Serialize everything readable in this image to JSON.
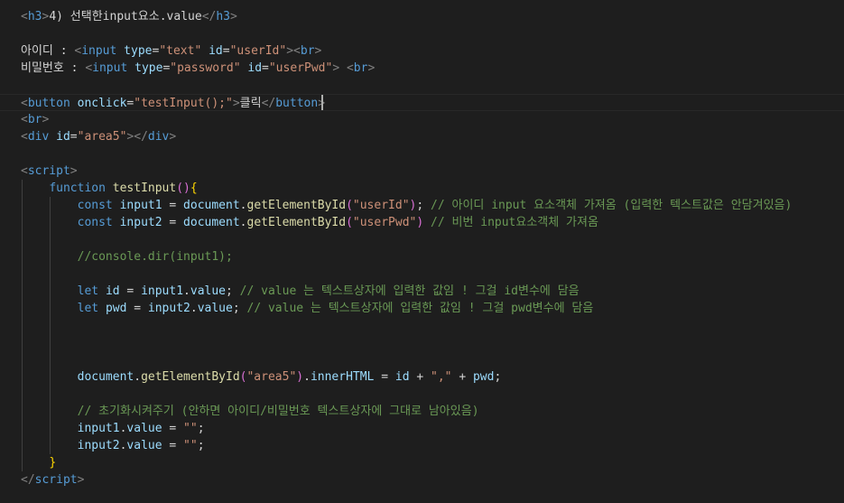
{
  "colors": {
    "tag": "#569cd6",
    "bracket": "#808080",
    "attr": "#9cdcfe",
    "string": "#ce9178",
    "text": "#d4d4d4",
    "keyword": "#569cd6",
    "function": "#dcdcaa",
    "comment": "#6a9955",
    "brace": "#ffd700",
    "paren": "#da70d6"
  },
  "lines": [
    [
      [
        "<",
        "bracket"
      ],
      [
        "h3",
        "tag"
      ],
      [
        ">",
        "bracket"
      ],
      [
        "4) 선택한input요소.value",
        "text"
      ],
      [
        "</",
        "bracket"
      ],
      [
        "h3",
        "tag"
      ],
      [
        ">",
        "bracket"
      ]
    ],
    [],
    [
      [
        "아이디 : ",
        "text"
      ],
      [
        "<",
        "bracket"
      ],
      [
        "input",
        "tag"
      ],
      [
        " ",
        "text"
      ],
      [
        "type",
        "attr"
      ],
      [
        "=",
        "text"
      ],
      [
        "\"text\"",
        "string"
      ],
      [
        " ",
        "text"
      ],
      [
        "id",
        "attr"
      ],
      [
        "=",
        "text"
      ],
      [
        "\"userId\"",
        "string"
      ],
      [
        ">",
        "bracket"
      ],
      [
        "<",
        "bracket"
      ],
      [
        "br",
        "tag"
      ],
      [
        ">",
        "bracket"
      ]
    ],
    [
      [
        "비밀번호 : ",
        "text"
      ],
      [
        "<",
        "bracket"
      ],
      [
        "input",
        "tag"
      ],
      [
        " ",
        "text"
      ],
      [
        "type",
        "attr"
      ],
      [
        "=",
        "text"
      ],
      [
        "\"password\"",
        "string"
      ],
      [
        " ",
        "text"
      ],
      [
        "id",
        "attr"
      ],
      [
        "=",
        "text"
      ],
      [
        "\"userPwd\"",
        "string"
      ],
      [
        ">",
        "bracket"
      ],
      [
        " ",
        "text"
      ],
      [
        "<",
        "bracket"
      ],
      [
        "br",
        "tag"
      ],
      [
        ">",
        "bracket"
      ]
    ],
    [],
    [
      [
        "<",
        "bracket"
      ],
      [
        "button",
        "tag"
      ],
      [
        " ",
        "text"
      ],
      [
        "onclick",
        "attr"
      ],
      [
        "=",
        "text"
      ],
      [
        "\"testInput();\"",
        "string"
      ],
      [
        ">",
        "bracket"
      ],
      [
        "클릭",
        "text"
      ],
      [
        "</",
        "bracket"
      ],
      [
        "button",
        "tag"
      ],
      [
        ">",
        "bracket"
      ]
    ],
    [
      [
        "<",
        "bracket"
      ],
      [
        "br",
        "tag"
      ],
      [
        ">",
        "bracket"
      ]
    ],
    [
      [
        "<",
        "bracket"
      ],
      [
        "div",
        "tag"
      ],
      [
        " ",
        "text"
      ],
      [
        "id",
        "attr"
      ],
      [
        "=",
        "text"
      ],
      [
        "\"area5\"",
        "string"
      ],
      [
        ">",
        "bracket"
      ],
      [
        "</",
        "bracket"
      ],
      [
        "div",
        "tag"
      ],
      [
        ">",
        "bracket"
      ]
    ],
    [],
    [
      [
        "<",
        "bracket"
      ],
      [
        "script",
        "tag"
      ],
      [
        ">",
        "bracket"
      ]
    ],
    [
      [
        "    ",
        "text"
      ],
      [
        "function",
        "keyword"
      ],
      [
        " ",
        "text"
      ],
      [
        "testInput",
        "function"
      ],
      [
        "()",
        "paren"
      ],
      [
        "{",
        "brace"
      ]
    ],
    [
      [
        "        ",
        "text"
      ],
      [
        "const",
        "keyword"
      ],
      [
        " ",
        "text"
      ],
      [
        "input1",
        "attr"
      ],
      [
        " = ",
        "text"
      ],
      [
        "document",
        "attr"
      ],
      [
        ".",
        "text"
      ],
      [
        "getElementById",
        "function"
      ],
      [
        "(",
        "paren"
      ],
      [
        "\"userId\"",
        "string"
      ],
      [
        ")",
        "paren"
      ],
      [
        "; ",
        "text"
      ],
      [
        "// 아이디 input 요소객체 가져옴 (입력한 텍스트값은 안담겨있음)",
        "comment"
      ]
    ],
    [
      [
        "        ",
        "text"
      ],
      [
        "const",
        "keyword"
      ],
      [
        " ",
        "text"
      ],
      [
        "input2",
        "attr"
      ],
      [
        " = ",
        "text"
      ],
      [
        "document",
        "attr"
      ],
      [
        ".",
        "text"
      ],
      [
        "getElementById",
        "function"
      ],
      [
        "(",
        "paren"
      ],
      [
        "\"userPwd\"",
        "string"
      ],
      [
        ")",
        "paren"
      ],
      [
        " ",
        "text"
      ],
      [
        "// 비번 input요소객체 가져옴",
        "comment"
      ]
    ],
    [],
    [
      [
        "        ",
        "text"
      ],
      [
        "//console.dir(input1);",
        "comment"
      ]
    ],
    [],
    [
      [
        "        ",
        "text"
      ],
      [
        "let",
        "keyword"
      ],
      [
        " ",
        "text"
      ],
      [
        "id",
        "attr"
      ],
      [
        " = ",
        "text"
      ],
      [
        "input1",
        "attr"
      ],
      [
        ".",
        "text"
      ],
      [
        "value",
        "attr"
      ],
      [
        "; ",
        "text"
      ],
      [
        "// value 는 텍스트상자에 입력한 값임 ! 그걸 id변수에 담음",
        "comment"
      ]
    ],
    [
      [
        "        ",
        "text"
      ],
      [
        "let",
        "keyword"
      ],
      [
        " ",
        "text"
      ],
      [
        "pwd",
        "attr"
      ],
      [
        " = ",
        "text"
      ],
      [
        "input2",
        "attr"
      ],
      [
        ".",
        "text"
      ],
      [
        "value",
        "attr"
      ],
      [
        "; ",
        "text"
      ],
      [
        "// value 는 텍스트상자에 입력한 값임 ! 그걸 pwd변수에 담음",
        "comment"
      ]
    ],
    [],
    [],
    [],
    [
      [
        "        ",
        "text"
      ],
      [
        "document",
        "attr"
      ],
      [
        ".",
        "text"
      ],
      [
        "getElementById",
        "function"
      ],
      [
        "(",
        "paren"
      ],
      [
        "\"area5\"",
        "string"
      ],
      [
        ")",
        "paren"
      ],
      [
        ".",
        "text"
      ],
      [
        "innerHTML",
        "attr"
      ],
      [
        " = ",
        "text"
      ],
      [
        "id",
        "attr"
      ],
      [
        " + ",
        "text"
      ],
      [
        "\",\"",
        "string"
      ],
      [
        " + ",
        "text"
      ],
      [
        "pwd",
        "attr"
      ],
      [
        ";",
        "text"
      ]
    ],
    [],
    [
      [
        "        ",
        "text"
      ],
      [
        "// 초기화시켜주기 (안하면 아이디/비밀번호 텍스트상자에 그대로 남아있음)",
        "comment"
      ]
    ],
    [
      [
        "        ",
        "text"
      ],
      [
        "input1",
        "attr"
      ],
      [
        ".",
        "text"
      ],
      [
        "value",
        "attr"
      ],
      [
        " = ",
        "text"
      ],
      [
        "\"\"",
        "string"
      ],
      [
        ";",
        "text"
      ]
    ],
    [
      [
        "        ",
        "text"
      ],
      [
        "input2",
        "attr"
      ],
      [
        ".",
        "text"
      ],
      [
        "value",
        "attr"
      ],
      [
        " = ",
        "text"
      ],
      [
        "\"\"",
        "string"
      ],
      [
        ";",
        "text"
      ]
    ],
    [
      [
        "    ",
        "text"
      ],
      [
        "}",
        "brace"
      ]
    ],
    [
      [
        "<",
        "bracket"
      ],
      [
        "/",
        "bracket"
      ],
      [
        "script",
        "tag"
      ],
      [
        ">",
        "bracket"
      ]
    ]
  ]
}
